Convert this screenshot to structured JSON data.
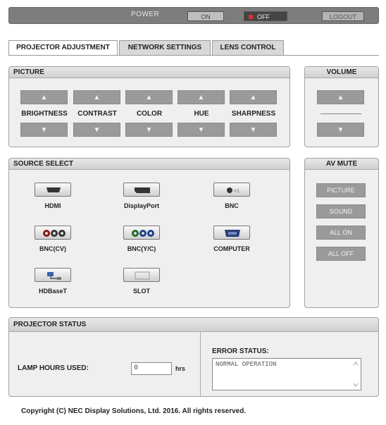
{
  "top_bar": {
    "power_label": "POWER",
    "on_label": "ON",
    "off_label": "OFF",
    "logout_label": "LOGOUT"
  },
  "tabs": [
    {
      "label": "PROJECTOR ADJUSTMENT",
      "active": true
    },
    {
      "label": "NETWORK SETTINGS",
      "active": false
    },
    {
      "label": "LENS CONTROL",
      "active": false
    }
  ],
  "picture": {
    "title": "PICTURE",
    "up_glyph": "▲",
    "down_glyph": "▼",
    "items": [
      "BRIGHTNESS",
      "CONTRAST",
      "COLOR",
      "HUE",
      "SHARPNESS"
    ]
  },
  "volume": {
    "title": "VOLUME",
    "up_glyph": "▲",
    "down_glyph": "▼"
  },
  "source_select": {
    "title": "SOURCE SELECT",
    "sources": [
      {
        "label": "HDMI",
        "icon": "hdmi-port-icon"
      },
      {
        "label": "DisplayPort",
        "icon": "displayport-icon"
      },
      {
        "label": "BNC",
        "icon": "bnc-connector-icon"
      },
      {
        "label": "BNC(CV)",
        "icon": "bnc-cv-connector-icon"
      },
      {
        "label": "BNC(Y/C)",
        "icon": "bnc-yc-connector-icon"
      },
      {
        "label": "COMPUTER",
        "icon": "vga-port-icon"
      },
      {
        "label": "HDBaseT",
        "icon": "hdbaset-network-icon"
      },
      {
        "label": "SLOT",
        "icon": "slot-icon"
      }
    ]
  },
  "av_mute": {
    "title": "AV MUTE",
    "buttons": [
      "PICTURE",
      "SOUND",
      "ALL ON",
      "ALL OFF"
    ]
  },
  "projector_status": {
    "title": "PROJECTOR STATUS",
    "lamp_hours_label": "LAMP HOURS USED:",
    "lamp_hours_value": "0",
    "lamp_hours_unit": "hrs",
    "error_status_label": "ERROR STATUS:",
    "error_status_value": "NORMAL OPERATION"
  },
  "footer": {
    "copyright": "Copyright (C) NEC Display Solutions, Ltd. 2016. All rights reserved."
  },
  "colors": {
    "button_gray": "#9a9a9a",
    "panel_bg": "#efefef",
    "topbar_bg": "#7d7d7d",
    "off_led": "#dd3333"
  }
}
